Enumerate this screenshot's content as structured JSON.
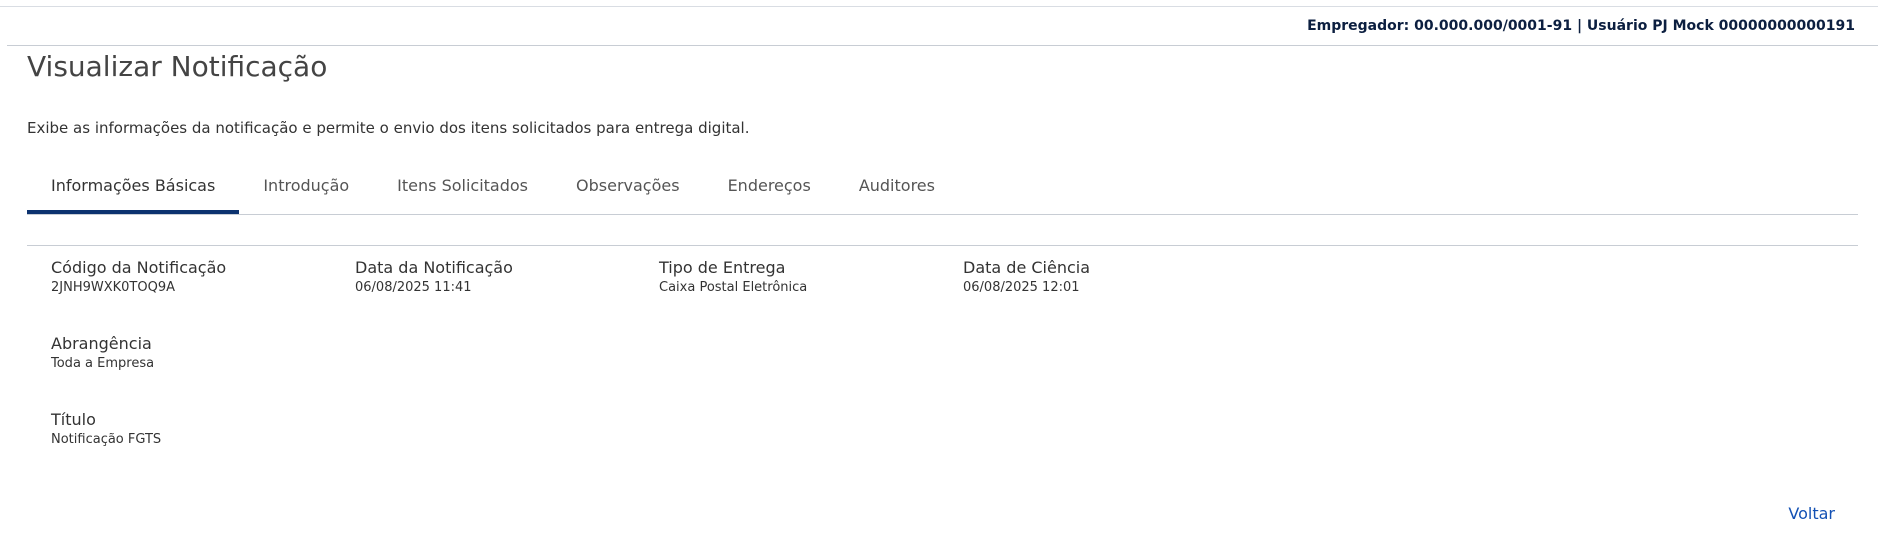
{
  "header": {
    "user_info": "Empregador: 00.000.000/0001-91 | Usuário PJ Mock 00000000000191"
  },
  "page": {
    "title": "Visualizar Notificação",
    "description": "Exibe as informações da notificação e permite o envio dos itens solicitados para entrega digital."
  },
  "tabs": [
    {
      "label": "Informações Básicas",
      "active": true
    },
    {
      "label": "Introdução",
      "active": false
    },
    {
      "label": "Itens Solicitados",
      "active": false
    },
    {
      "label": "Observações",
      "active": false
    },
    {
      "label": "Endereços",
      "active": false
    },
    {
      "label": "Auditores",
      "active": false
    }
  ],
  "fields": {
    "codigo": {
      "label": "Código da Notificação",
      "value": "2JNH9WXK0TOQ9A"
    },
    "data_notificacao": {
      "label": "Data da Notificação",
      "value": "06/08/2025 11:41"
    },
    "tipo_entrega": {
      "label": "Tipo de Entrega",
      "value": "Caixa Postal Eletrônica"
    },
    "data_ciencia": {
      "label": "Data de Ciência",
      "value": "06/08/2025 12:01"
    },
    "abrangencia": {
      "label": "Abrangência",
      "value": "Toda a Empresa"
    },
    "titulo": {
      "label": "Título",
      "value": "Notificação FGTS"
    }
  },
  "actions": {
    "back_label": "Voltar"
  },
  "colors": {
    "accent": "#0c326f",
    "link": "#1351b4",
    "header_text": "#0c1f40"
  }
}
